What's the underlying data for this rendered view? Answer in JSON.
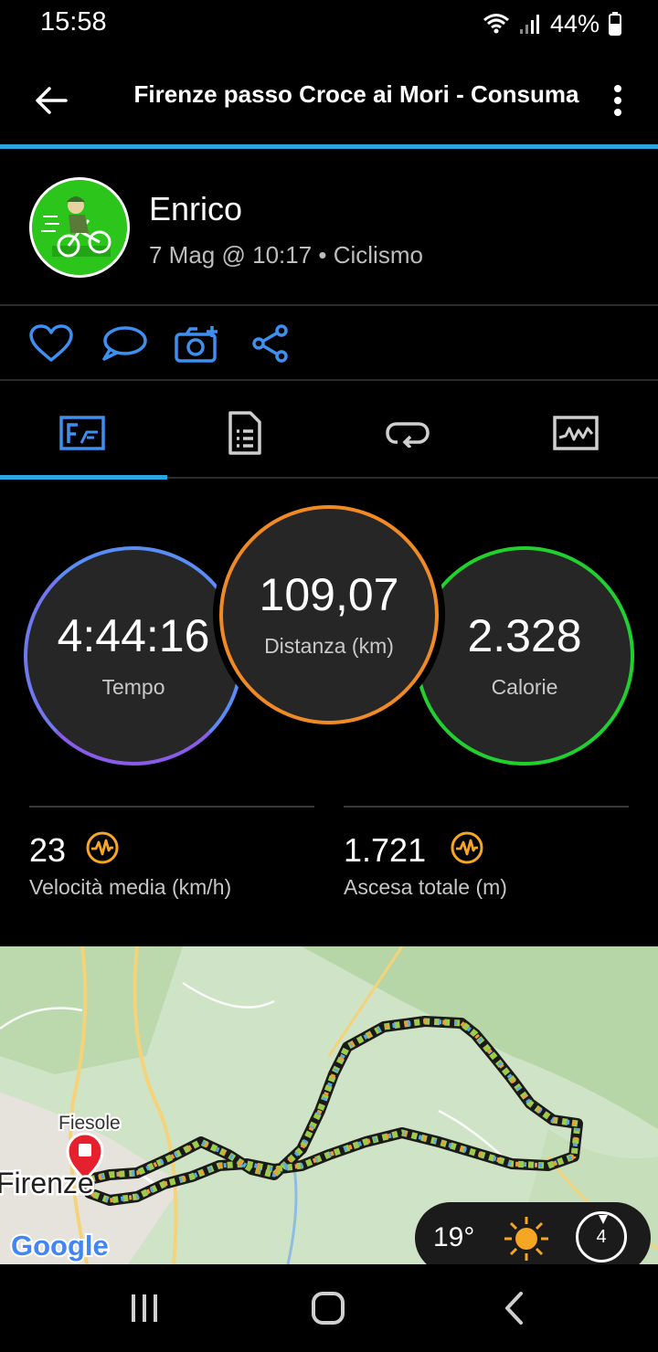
{
  "status_bar": {
    "time": "15:58",
    "battery": "44%",
    "icons": [
      "wifi-icon",
      "signal-icon",
      "battery-icon"
    ]
  },
  "app_bar": {
    "title": "Firenze passo Croce ai Mori - Consuma",
    "icons": [
      "back-arrow-icon",
      "more-vert-icon"
    ]
  },
  "profile": {
    "name": "Enrico",
    "meta": "7 Mag @ 10:17 • Ciclismo"
  },
  "actions": {
    "icons": [
      "heart-icon",
      "comment-icon",
      "add-photo-icon",
      "share-icon"
    ]
  },
  "tabs": {
    "icons": [
      "overview-icon",
      "details-icon",
      "laps-icon",
      "charts-icon"
    ],
    "active_index": 0
  },
  "stats": {
    "time": {
      "value": "4:44:16",
      "label": "Tempo"
    },
    "distance": {
      "value": "109,07",
      "label": "Distanza (km)"
    },
    "calories": {
      "value": "2.328",
      "label": "Calorie"
    }
  },
  "secondary_stats": {
    "avg_speed": {
      "value": "23",
      "label": "Velocità media (km/h)"
    },
    "total_ascent": {
      "value": "1.721",
      "label": "Ascesa totale (m)"
    }
  },
  "map": {
    "place_labels": [
      "Fiesole",
      "Firenze"
    ],
    "attribution": "Google",
    "weather": {
      "temperature": "19°",
      "wind": "4"
    }
  },
  "colors": {
    "accent": "#2aa6e0",
    "time_ring": "#5b8cf5",
    "distance_ring": "#f08a24",
    "calories_ring": "#20d12e",
    "badge_orange": "#f5a623",
    "map_pin": "#e5212d"
  },
  "nav_bar": {
    "icons": [
      "recents-icon",
      "home-icon",
      "back-icon"
    ]
  }
}
